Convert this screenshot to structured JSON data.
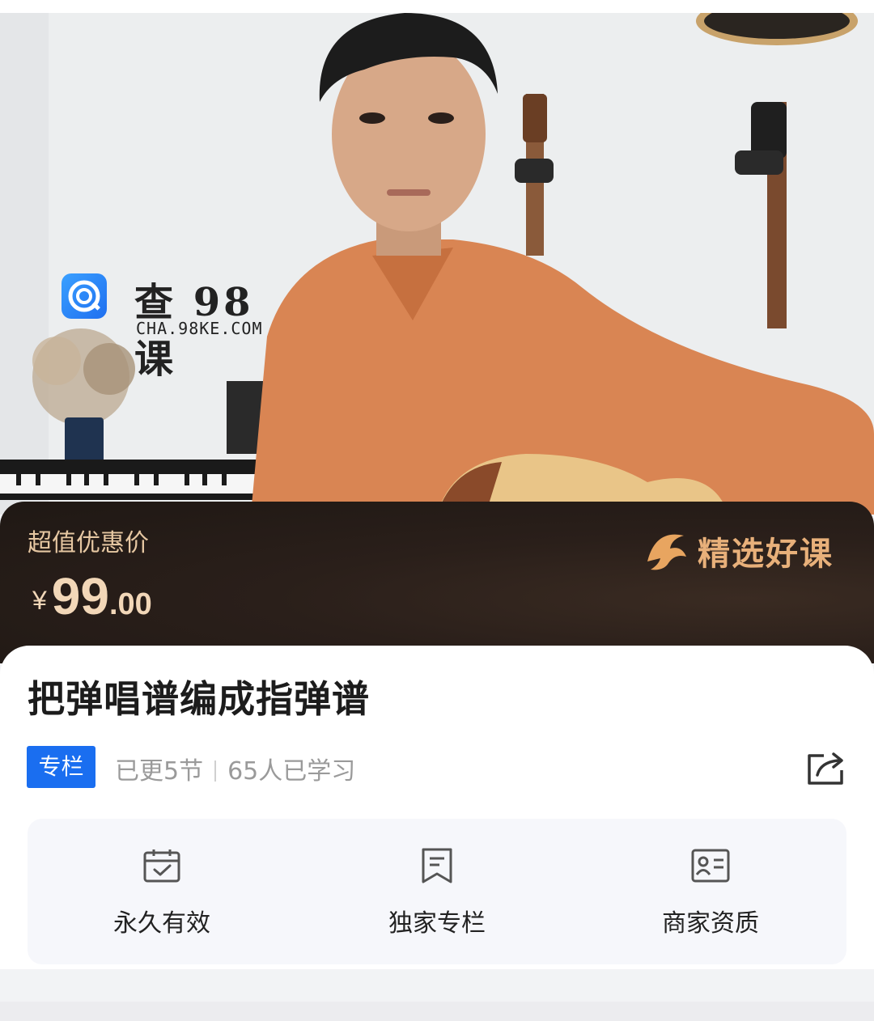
{
  "watermark": {
    "title": "查 98 课",
    "subtitle": "CHA.98KE.COM"
  },
  "price_bar": {
    "label": "超值优惠价",
    "currency": "¥",
    "price_int": "99",
    "price_dec": ".00",
    "badge": "精选好课"
  },
  "course": {
    "title": "把弹唱谱编成指弹谱",
    "tag": "专栏",
    "updates": "已更5节",
    "learners": "65人已学习"
  },
  "features": [
    {
      "label": "永久有效",
      "icon": "calendar-check-icon"
    },
    {
      "label": "独家专栏",
      "icon": "bookmark-doc-icon"
    },
    {
      "label": "商家资质",
      "icon": "id-card-icon"
    }
  ],
  "colors": {
    "tag_blue": "#1a6ef0",
    "price_gold": "#f2d7b8",
    "bar_dark": "#2a1f1a",
    "shirt_orange": "#d98553"
  }
}
